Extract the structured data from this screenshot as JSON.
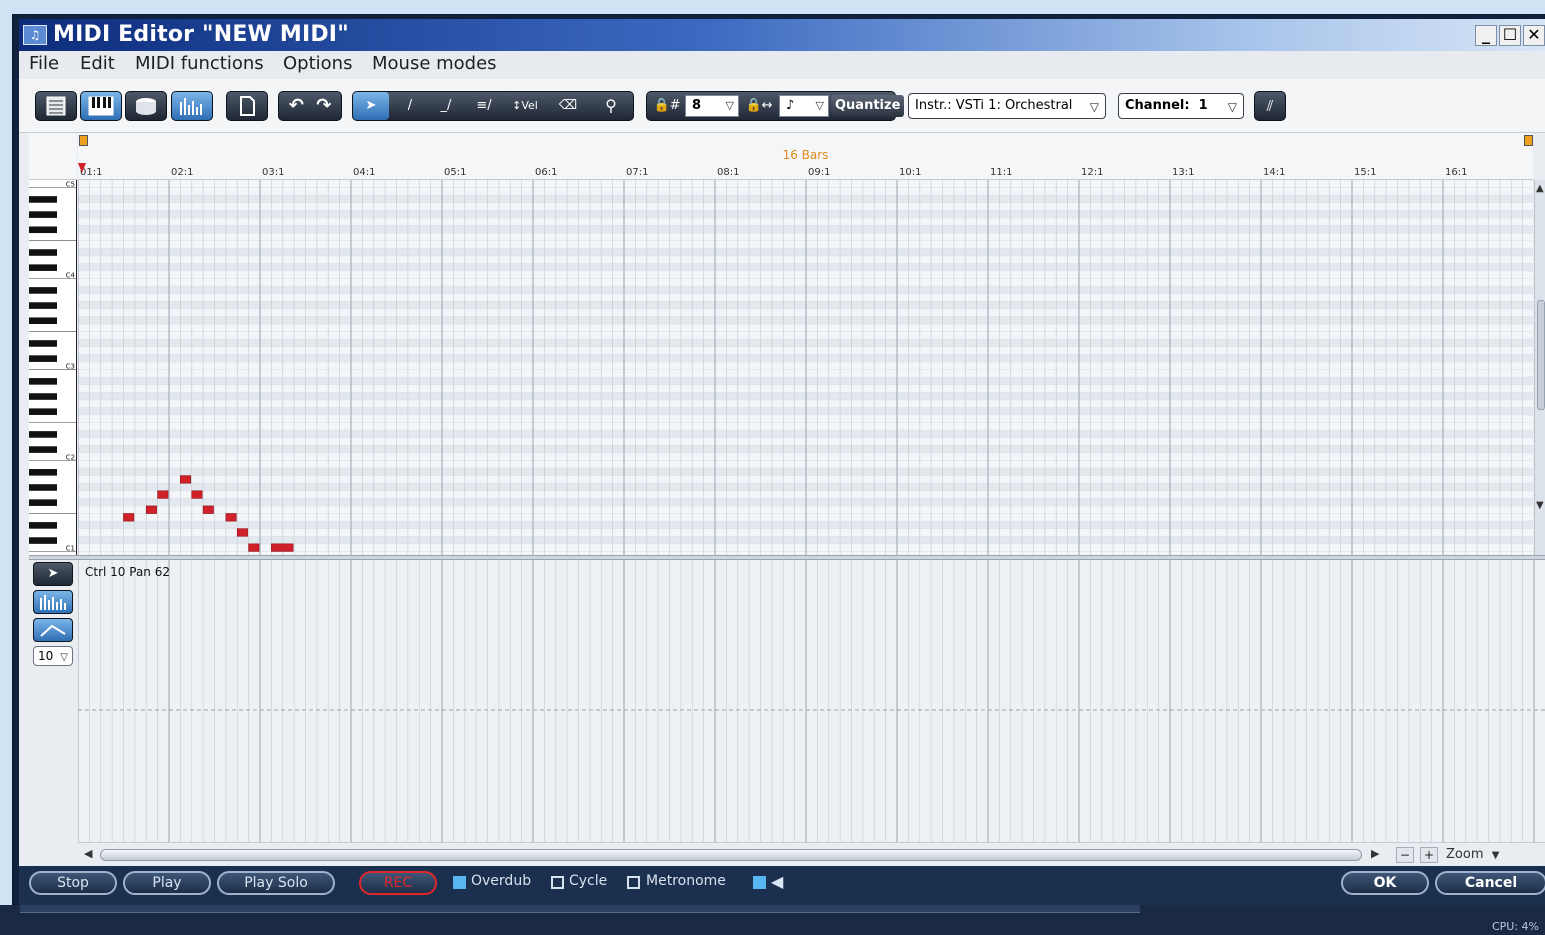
{
  "window": {
    "title": "MIDI Editor \"NEW MIDI\"",
    "controls": [
      "_",
      "☐",
      "✕"
    ]
  },
  "menu": [
    "File",
    "Edit",
    "MIDI functions",
    "Options",
    "Mouse modes"
  ],
  "toolbar": {
    "view_buttons": [
      "list-view-icon",
      "piano-roll-icon",
      "drum-editor-icon",
      "score-icon"
    ],
    "action_buttons": [
      "new-document-icon",
      "undo-icon",
      "redo-icon"
    ],
    "tools": [
      "pointer-icon",
      "pencil-icon",
      "line-draw-icon",
      "multi-draw-icon",
      "velocity-icon",
      "eraser-icon",
      "zoom-icon"
    ],
    "velocity_label": "Vel",
    "grid_value": "8",
    "length_value": "♪",
    "quantize_label": "Quantize",
    "instrument": "Instr.: VSTi 1: Orchestral",
    "channel_label": "Channel:",
    "channel_value": "1"
  },
  "ruler": {
    "label": "16 Bars",
    "bars": [
      "01:1",
      "02:1",
      "03:1",
      "04:1",
      "05:1",
      "06:1",
      "07:1",
      "08:1",
      "09:1",
      "10:1",
      "11:1",
      "12:1",
      "13:1",
      "14:1",
      "15:1",
      "16:1"
    ]
  },
  "keyboard": {
    "octave_labels": [
      "C5",
      "C4",
      "C3",
      "C2",
      "C1"
    ]
  },
  "notes": [
    {
      "start": 0.5,
      "len": 0.125,
      "pitch": 52
    },
    {
      "start": 0.75,
      "len": 0.125,
      "pitch": 53
    },
    {
      "start": 0.875,
      "len": 0.125,
      "pitch": 55
    },
    {
      "start": 1.125,
      "len": 0.125,
      "pitch": 57
    },
    {
      "start": 1.25,
      "len": 0.125,
      "pitch": 55
    },
    {
      "start": 1.375,
      "len": 0.125,
      "pitch": 53
    },
    {
      "start": 1.625,
      "len": 0.125,
      "pitch": 52
    },
    {
      "start": 1.75,
      "len": 0.125,
      "pitch": 50
    },
    {
      "start": 1.875,
      "len": 0.125,
      "pitch": 48
    },
    {
      "start": 2.125,
      "len": 0.25,
      "pitch": 48
    }
  ],
  "controller": {
    "label": "Ctrl 10 Pan 62",
    "number": "10",
    "tools": [
      "pointer-icon",
      "bars-icon",
      "curve-icon"
    ]
  },
  "scroll": {
    "zoom_label": "Zoom",
    "minus": "−",
    "plus": "+"
  },
  "transport": {
    "stop": "Stop",
    "play": "Play",
    "play_solo": "Play Solo",
    "rec": "REC",
    "overdub": "Overdub",
    "cycle": "Cycle",
    "metronome": "Metronome",
    "ok": "OK",
    "cancel": "Cancel"
  },
  "status": {
    "cpu": "CPU:  4%"
  },
  "colors": {
    "note": "#d0212a",
    "accent": "#2f6eb4",
    "rec": "#e0262b",
    "ruler_label": "#e08a1c"
  }
}
